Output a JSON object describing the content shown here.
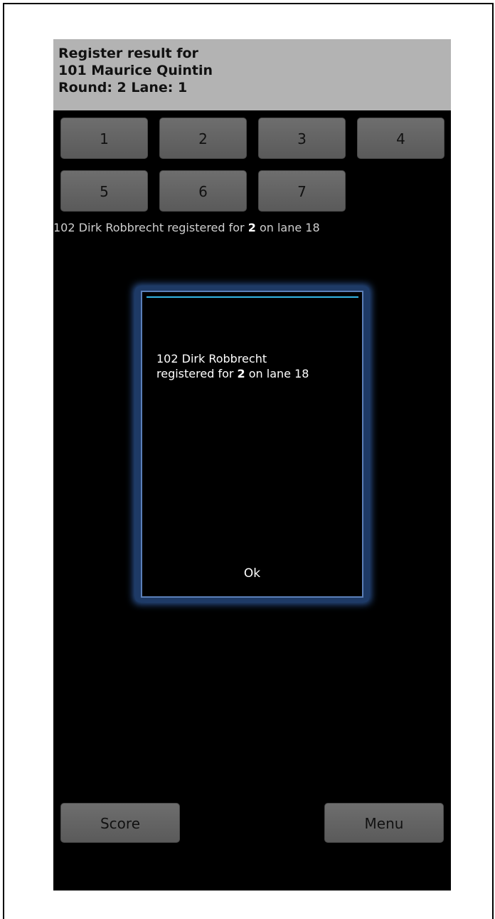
{
  "header": {
    "line1": "Register result for",
    "line2": "101 Maurice Quintin",
    "line3": "Round: 2 Lane: 1"
  },
  "number_buttons": [
    "1",
    "2",
    "3",
    "4",
    "5",
    "6",
    "7"
  ],
  "status": {
    "prefix": "102 Dirk Robbrecht registered for ",
    "value": "2",
    "suffix": " on lane 18"
  },
  "dialog": {
    "line1": "102 Dirk Robbrecht",
    "line2_prefix": "registered for ",
    "line2_value": "2",
    "line2_suffix": " on lane 18",
    "ok_label": "Ok"
  },
  "bottom": {
    "score_label": "Score",
    "menu_label": "Menu"
  }
}
